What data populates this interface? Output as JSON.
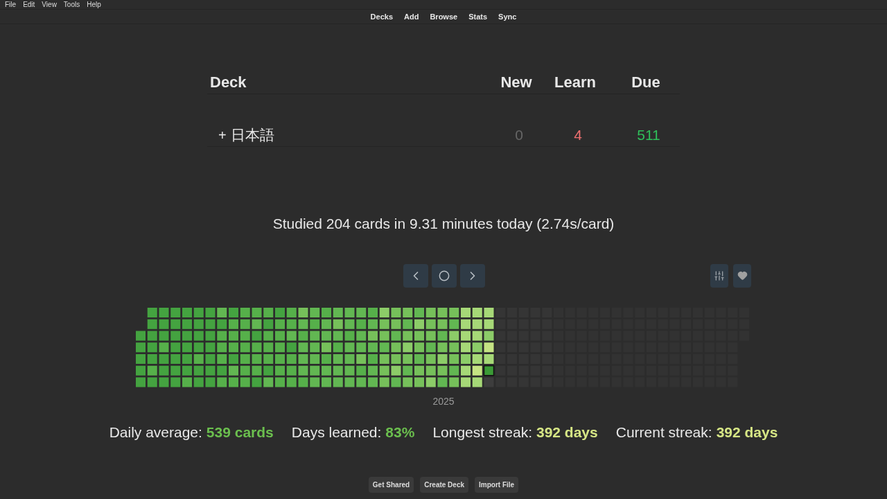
{
  "menu": [
    "File",
    "Edit",
    "View",
    "Tools",
    "Help"
  ],
  "nav": [
    "Decks",
    "Add",
    "Browse",
    "Stats",
    "Sync"
  ],
  "table": {
    "columns": [
      "Deck",
      "New",
      "Learn",
      "Due"
    ],
    "rows": [
      {
        "toggle": "+",
        "name": "日本語",
        "new": "0",
        "learn": "4",
        "due": "511"
      }
    ]
  },
  "studied": "Studied 204 cards in 9.31 minutes today (2.74s/card)",
  "heatmap": {
    "year": "2025"
  },
  "stats": [
    {
      "label": "Daily average:",
      "value": "539 cards",
      "color": "#6bbf4e"
    },
    {
      "label": "Days learned:",
      "value": "83%",
      "color": "#6bbf4e"
    },
    {
      "label": "Longest streak:",
      "value": "392 days",
      "color": "#d6e685"
    },
    {
      "label": "Current streak:",
      "value": "392 days",
      "color": "#d6e685"
    }
  ],
  "buttons": [
    "Get Shared",
    "Create Deck",
    "Import File"
  ]
}
